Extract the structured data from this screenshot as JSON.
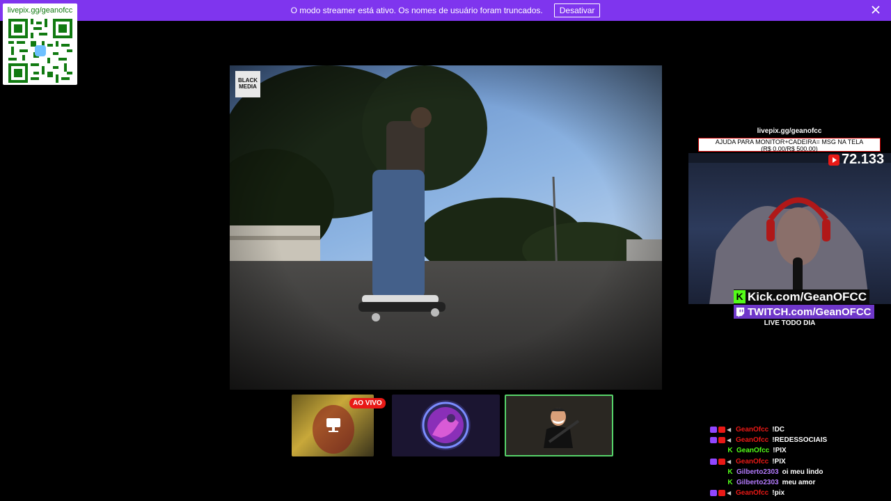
{
  "banner": {
    "message": "O modo streamer está ativo. Os nomes de usuário foram truncados.",
    "button_label": "Desativar",
    "color": "#7f35ee"
  },
  "qr": {
    "label": "livepix.gg/geanofcc",
    "color": "#117a11"
  },
  "video": {
    "watermark": "BLACK MEDIA"
  },
  "thumbnails": {
    "live_badge": "AO VIVO"
  },
  "overlay": {
    "site": "livepix.gg/geanofcc",
    "goal_line1": "AJUDA PARA MONITOR+CADEIRA= MSG NA TELA",
    "goal_line2": "(R$ 0.00/R$ 500.00)",
    "viewers": "72.133",
    "kick": "Kick.com/GeanOFCC",
    "twitch": "TWITCH.com/GeanOFCC",
    "live_every_day": "LIVE TODO DIA"
  },
  "chat": {
    "messages": [
      {
        "platform": "multi",
        "user": "GeanOfcc",
        "user_color": "#e91916",
        "text": "!DC"
      },
      {
        "platform": "multi",
        "user": "GeanOfcc",
        "user_color": "#e91916",
        "text": "!REDESSOCIAIS"
      },
      {
        "platform": "kick",
        "user": "GeanOfcc",
        "user_color": "#53fc18",
        "text": "!PIX"
      },
      {
        "platform": "multi",
        "user": "GeanOfcc",
        "user_color": "#e91916",
        "text": "!PIX"
      },
      {
        "platform": "kick",
        "user": "Gilberto2303",
        "user_color": "#b57cff",
        "text": "oi meu lindo"
      },
      {
        "platform": "kick",
        "user": "Gilberto2303",
        "user_color": "#b57cff",
        "text": "meu amor"
      },
      {
        "platform": "multi",
        "user": "GeanOfcc",
        "user_color": "#e91916",
        "text": "!pix"
      }
    ]
  }
}
